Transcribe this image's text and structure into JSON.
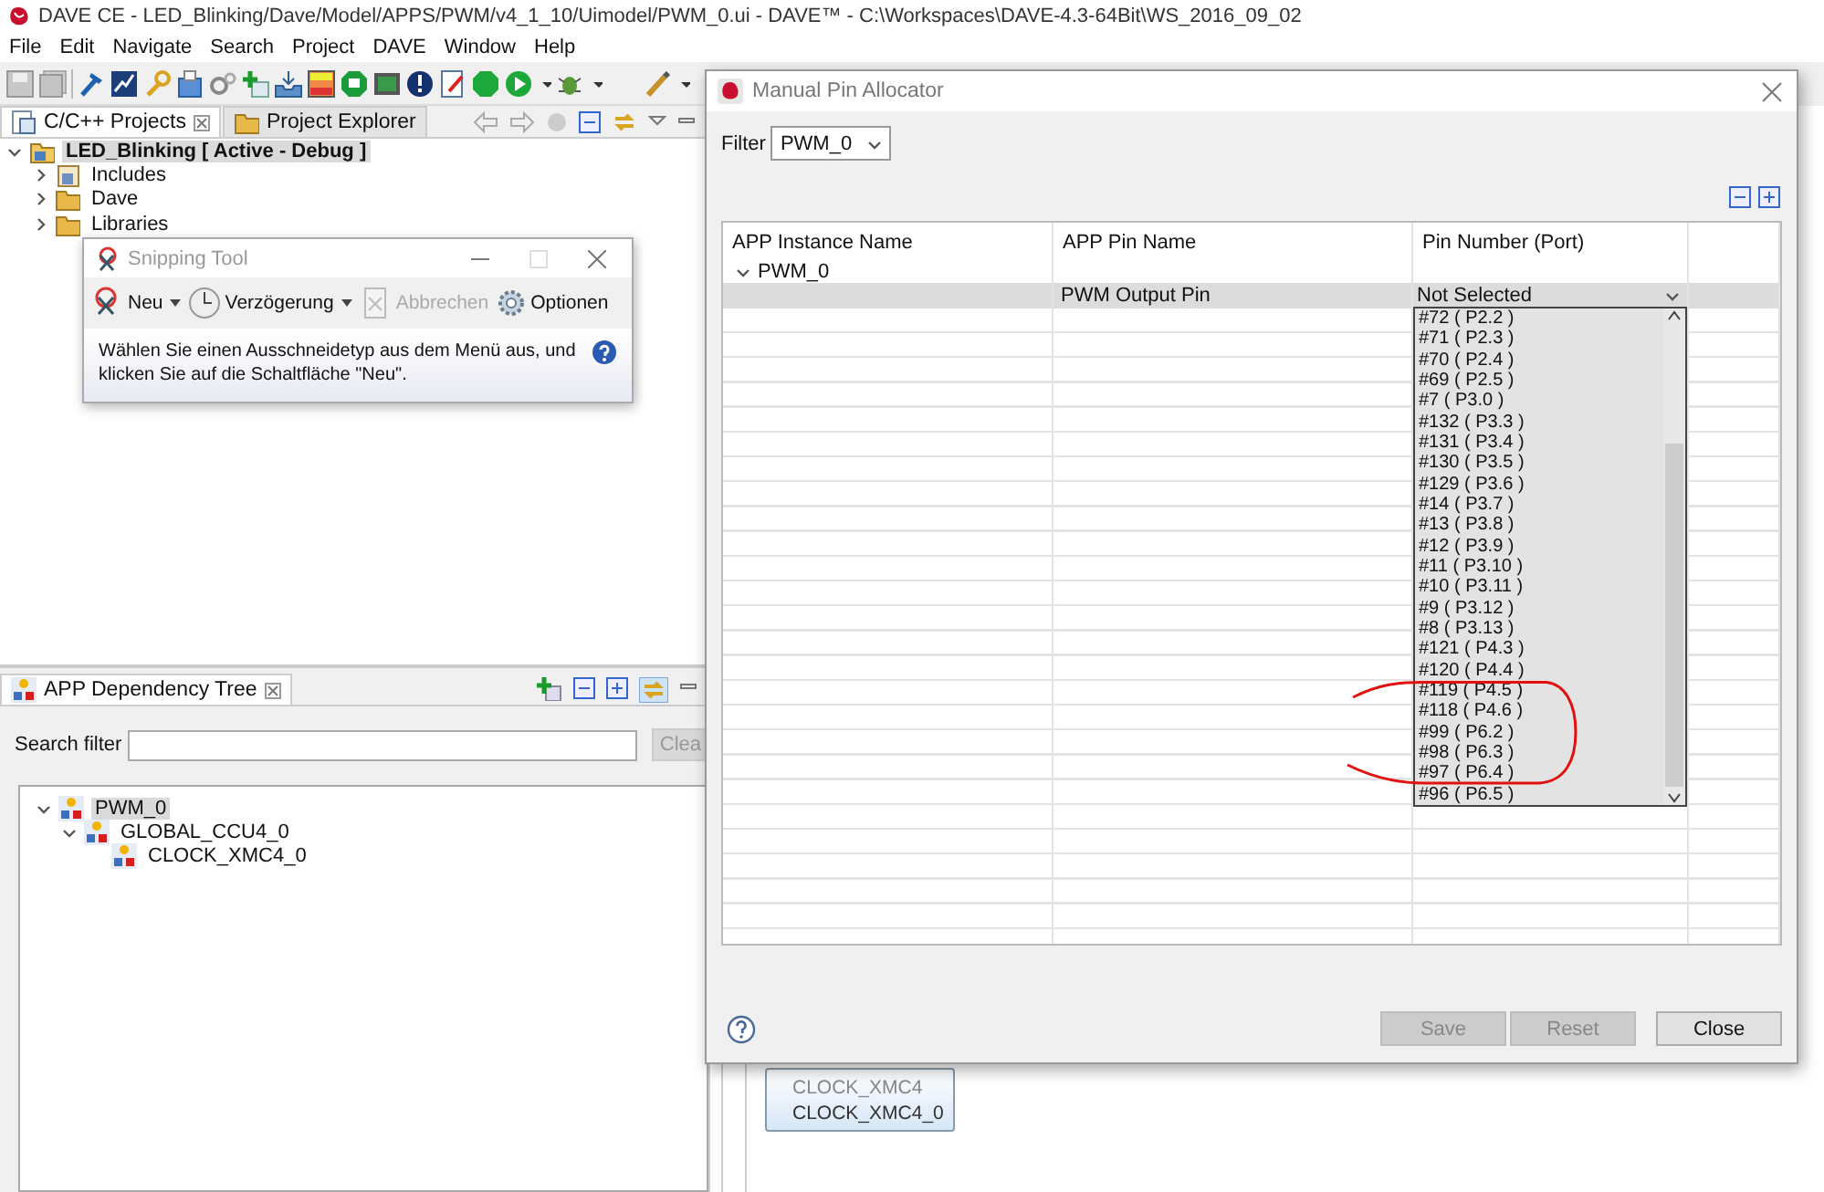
{
  "window": {
    "title": "DAVE CE - LED_Blinking/Dave/Model/APPS/PWM/v4_1_10/Uimodel/PWM_0.ui - DAVE™ - C:\\Workspaces\\DAVE-4.3-64Bit\\WS_2016_09_02"
  },
  "menu": [
    "File",
    "Edit",
    "Navigate",
    "Search",
    "Project",
    "DAVE",
    "Window",
    "Help"
  ],
  "projects_view": {
    "tabs": [
      {
        "label": "C/C++ Projects",
        "selected": true
      },
      {
        "label": "Project Explorer",
        "selected": false
      }
    ],
    "tree": [
      {
        "label": "LED_Blinking [ Active - Debug ]",
        "selected": true,
        "expanded": true,
        "children": [
          {
            "label": "Includes",
            "selected": false,
            "expanded": false
          },
          {
            "label": "Dave",
            "selected": false,
            "expanded": false
          },
          {
            "label": "Libraries",
            "selected": false,
            "expanded": false
          }
        ]
      }
    ]
  },
  "dependency_view": {
    "tab": "APP Dependency Tree",
    "search_label": "Search filter",
    "clear_button": "Clea",
    "tree": [
      {
        "label": "PWM_0",
        "selected": true,
        "expanded": true,
        "children": [
          {
            "label": "GLOBAL_CCU4_0",
            "selected": false,
            "expanded": true,
            "children": [
              {
                "label": "CLOCK_XMC4_0",
                "selected": false
              }
            ]
          }
        ]
      }
    ]
  },
  "diagram": {
    "node": {
      "type": "CLOCK_XMC4",
      "name": "CLOCK_XMC4_0"
    }
  },
  "snipping_tool": {
    "title": "Snipping Tool",
    "buttons": [
      {
        "label": "Neu",
        "kind": "new",
        "has_menu": true,
        "disabled": false
      },
      {
        "label": "Verzögerung",
        "kind": "delay",
        "has_menu": true,
        "disabled": false
      },
      {
        "label": "Abbrechen",
        "kind": "cancel",
        "has_menu": false,
        "disabled": true
      },
      {
        "label": "Optionen",
        "kind": "options",
        "has_menu": false,
        "disabled": false
      }
    ],
    "message": "Wählen Sie einen Ausschneidetyp aus dem Menü aus, und klicken Sie auf die Schaltfläche \"Neu\"."
  },
  "pin_allocator": {
    "title": "Manual Pin Allocator",
    "filter_label": "Filter",
    "filter_value": "PWM_0",
    "columns": [
      "APP Instance Name",
      "APP Pin Name",
      "Pin Number (Port)"
    ],
    "instance": {
      "name": "PWM_0",
      "expanded": true
    },
    "rows": [
      {
        "pin_name": "PWM Output Pin",
        "pin_number": "Not Selected"
      }
    ],
    "dropdown_options": [
      "#72 ( P2.2 )",
      "#71 ( P2.3 )",
      "#70 ( P2.4 )",
      "#69 ( P2.5 )",
      "#7 ( P3.0 )",
      "#132 ( P3.3 )",
      "#131 ( P3.4 )",
      "#130 ( P3.5 )",
      "#129 ( P3.6 )",
      "#14 ( P3.7 )",
      "#13 ( P3.8 )",
      "#12 ( P3.9 )",
      "#11 ( P3.10 )",
      "#10 ( P3.11 )",
      "#9 ( P3.12 )",
      "#8 ( P3.13 )",
      "#121 ( P4.3 )",
      "#120 ( P4.4 )",
      "#119 ( P4.5 )",
      "#118 ( P4.6 )",
      "#99 ( P6.2 )",
      "#98 ( P6.3 )",
      "#97 ( P6.4 )",
      "#96 ( P6.5 )"
    ],
    "buttons": [
      {
        "label": "Save",
        "disabled": true
      },
      {
        "label": "Reset",
        "disabled": true
      },
      {
        "label": "Close",
        "disabled": false
      }
    ]
  }
}
